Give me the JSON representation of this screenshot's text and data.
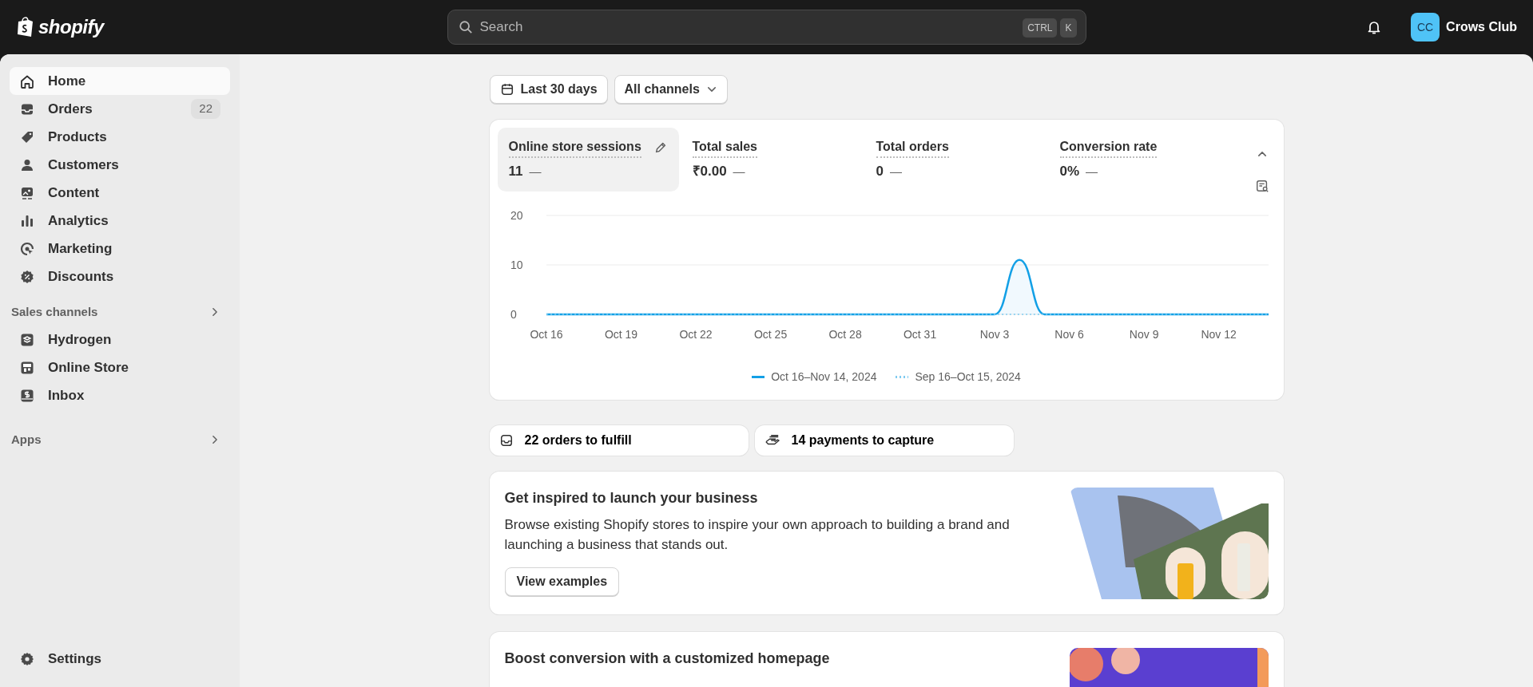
{
  "topbar": {
    "brand": "shopify",
    "search": {
      "placeholder": "Search"
    },
    "shortcut_keys": [
      "CTRL",
      "K"
    ],
    "avatar_initials": "CC",
    "store_name": "Crows Club"
  },
  "sidebar": {
    "items": [
      {
        "label": "Home",
        "selected": true
      },
      {
        "label": "Orders",
        "selected": false,
        "badge": "22"
      },
      {
        "label": "Products",
        "selected": false
      },
      {
        "label": "Customers",
        "selected": false
      },
      {
        "label": "Content",
        "selected": false
      },
      {
        "label": "Analytics",
        "selected": false
      },
      {
        "label": "Marketing",
        "selected": false
      },
      {
        "label": "Discounts",
        "selected": false
      }
    ],
    "sections": [
      {
        "title": "Sales channels",
        "items": [
          {
            "label": "Hydrogen",
            "selected": false
          },
          {
            "label": "Online Store",
            "selected": false
          },
          {
            "label": "Inbox",
            "selected": false
          }
        ]
      },
      {
        "title": "Apps"
      }
    ],
    "footer_item": {
      "label": "Settings",
      "selected": false
    }
  },
  "filters": [
    {
      "label": "Last 30 days",
      "kind": "date"
    },
    {
      "label": "All channels",
      "kind": "dropdown"
    }
  ],
  "metrics": [
    {
      "label": "Online store sessions",
      "value": "11",
      "change": "—",
      "selected": true
    },
    {
      "label": "Total sales",
      "value": "₹0.00",
      "change": "—",
      "selected": false
    },
    {
      "label": "Total orders",
      "value": "0",
      "change": "—",
      "selected": false
    },
    {
      "label": "Conversion rate",
      "value": "0%",
      "change": "—",
      "selected": false
    }
  ],
  "chart_data": {
    "type": "line",
    "categories": [
      "Oct 16",
      null,
      null,
      "Oct 19",
      null,
      null,
      "Oct 22",
      null,
      null,
      "Oct 25",
      null,
      null,
      "Oct 28",
      null,
      null,
      "Oct 31",
      null,
      null,
      "Nov 3",
      null,
      null,
      "Nov 6",
      null,
      null,
      "Nov 9",
      null,
      null,
      "Nov 12",
      null,
      null
    ],
    "series": [
      {
        "name": "Oct 16–Nov 14, 2024",
        "color": "#13a0e6",
        "values": [
          0,
          0,
          0,
          0,
          0,
          0,
          0,
          0,
          0,
          0,
          0,
          0,
          0,
          0,
          0,
          0,
          0,
          0,
          0,
          11,
          0,
          0,
          0,
          0,
          0,
          0,
          0,
          0,
          0,
          0
        ]
      },
      {
        "name": "Sep 16–Oct 15, 2024",
        "color": "#7fcbf0",
        "line_style": "dotted",
        "values": [
          0,
          0,
          0,
          0,
          0,
          0,
          0,
          0,
          0,
          0,
          0,
          0,
          0,
          0,
          0,
          0,
          0,
          0,
          0,
          0,
          0,
          0,
          0,
          0,
          0,
          0,
          0,
          0,
          0,
          0
        ]
      }
    ],
    "ylim": [
      0,
      20
    ],
    "yticks": [
      0,
      10,
      20
    ]
  },
  "tasks": [
    {
      "label": "22 orders to fulfill"
    },
    {
      "label": "14 payments to capture"
    }
  ],
  "cards": [
    {
      "title": "Get inspired to launch your business",
      "text": "Browse existing Shopify stores to inspire your own approach to building a brand and launching a business that stands out.",
      "button": "View examples"
    },
    {
      "title": "Boost conversion with a customized homepage"
    }
  ]
}
